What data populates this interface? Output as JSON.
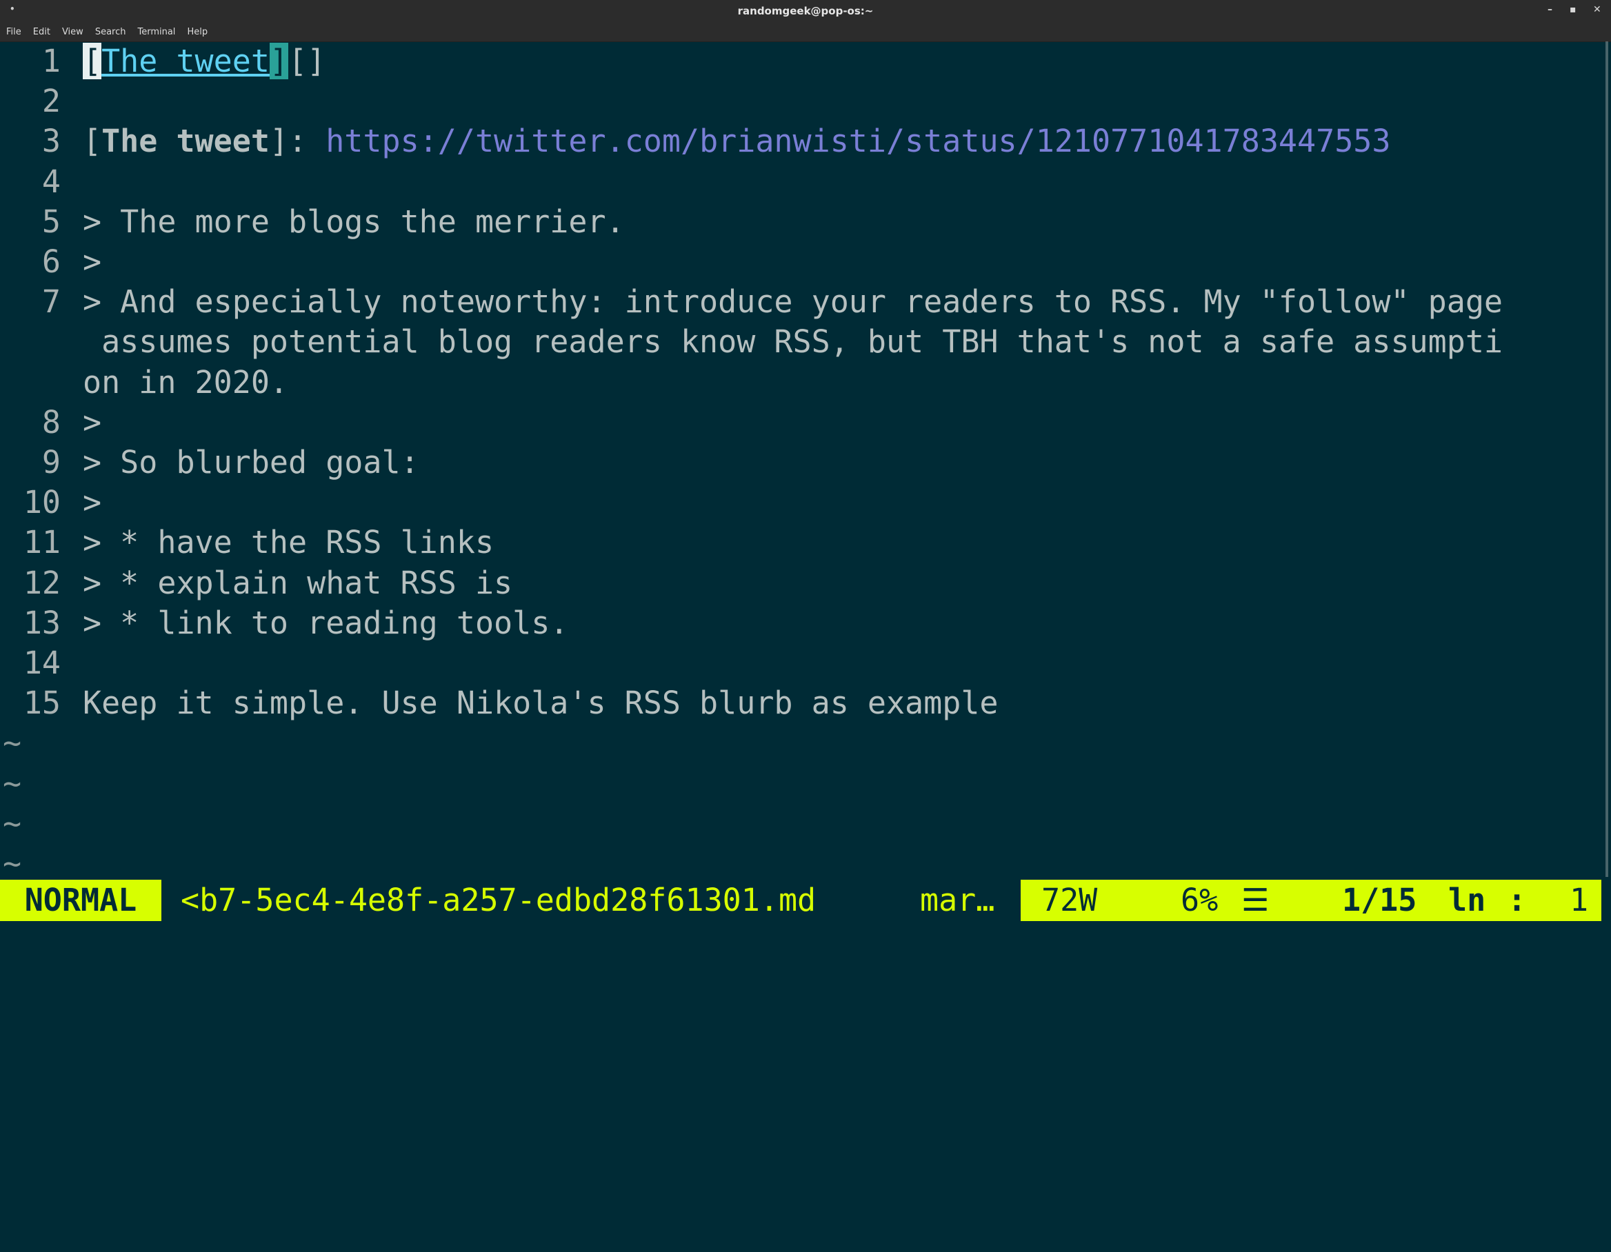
{
  "window": {
    "title": "randomgeek@pop-os:~",
    "menu": [
      "File",
      "Edit",
      "View",
      "Search",
      "Terminal",
      "Help"
    ],
    "controls": [
      "–",
      "▪",
      "✕"
    ]
  },
  "editor": {
    "lines": [
      {
        "n": "1",
        "parts": [
          {
            "t": "[",
            "c": "bracket-open"
          },
          {
            "t": "The tweet",
            "c": "link-text"
          },
          {
            "t": "]",
            "c": "bracket-close"
          },
          {
            "t": "[]",
            "c": ""
          }
        ]
      },
      {
        "n": "2",
        "parts": []
      },
      {
        "n": "3",
        "parts": [
          {
            "t": "[",
            "c": ""
          },
          {
            "t": "The tweet",
            "c": "bold-ref"
          },
          {
            "t": "]: ",
            "c": ""
          },
          {
            "t": "https://twitter.com/brianwisti/status/1210771041783447553",
            "c": "url"
          }
        ]
      },
      {
        "n": "4",
        "parts": []
      },
      {
        "n": "5",
        "parts": [
          {
            "t": "> The more blogs the merrier.",
            "c": ""
          }
        ]
      },
      {
        "n": "6",
        "parts": [
          {
            "t": ">",
            "c": ""
          }
        ]
      },
      {
        "n": "7",
        "parts": [
          {
            "t": "> And especially noteworthy: introduce your readers to RSS. My \"follow\" page",
            "c": ""
          }
        ]
      },
      {
        "n": "",
        "parts": [
          {
            "t": " assumes potential blog readers know RSS, but TBH that's not a safe assumpti",
            "c": ""
          }
        ]
      },
      {
        "n": "",
        "parts": [
          {
            "t": "on in 2020.",
            "c": ""
          }
        ]
      },
      {
        "n": "8",
        "parts": [
          {
            "t": ">",
            "c": ""
          }
        ]
      },
      {
        "n": "9",
        "parts": [
          {
            "t": "> So blurbed goal:",
            "c": ""
          }
        ]
      },
      {
        "n": "10",
        "parts": [
          {
            "t": ">",
            "c": ""
          }
        ]
      },
      {
        "n": "11",
        "parts": [
          {
            "t": "> * have the RSS links",
            "c": ""
          }
        ]
      },
      {
        "n": "12",
        "parts": [
          {
            "t": "> * explain what RSS is",
            "c": ""
          }
        ]
      },
      {
        "n": "13",
        "parts": [
          {
            "t": "> * link to reading tools.",
            "c": ""
          }
        ]
      },
      {
        "n": "14",
        "parts": []
      },
      {
        "n": "15",
        "parts": [
          {
            "t": "Keep it simple. Use Nikola's RSS blurb as example",
            "c": ""
          }
        ]
      }
    ],
    "tildes": [
      "~",
      "~",
      "~",
      "~"
    ]
  },
  "statusline": {
    "mode": "NORMAL",
    "filename": "<b7-5ec4-4e8f-a257-edbd28f61301.md",
    "filetype": "mar…",
    "words": "72W",
    "percent": "6%",
    "menu_glyph": "☰",
    "position": "1/15",
    "ln_label": "ln",
    "colon": ":",
    "column": "1"
  },
  "colors": {
    "background": "#002b36",
    "status_accent": "#d7ff00",
    "link": "#5fd1f2",
    "url": "#7a7fd6"
  }
}
